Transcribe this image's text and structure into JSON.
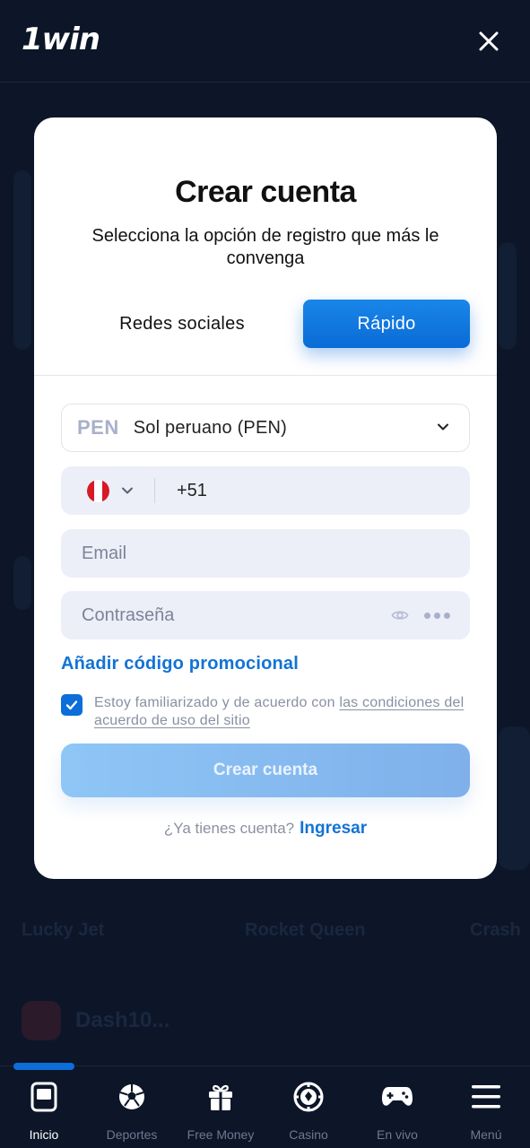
{
  "header": {
    "logo_text": "1win"
  },
  "background": {
    "games": [
      "Lucky Jet",
      "Rocket Queen",
      "Crash"
    ],
    "row_label": "Dash10..."
  },
  "modal": {
    "title": "Crear cuenta",
    "subtitle": "Selecciona la opción de registro que más le convenga",
    "tabs": {
      "social": "Redes sociales",
      "fast": "Rápido",
      "active": "fast"
    },
    "currency": {
      "code": "PEN",
      "name": "Sol peruano (PEN)"
    },
    "phone": {
      "country": "Peru",
      "value": "+51"
    },
    "email": {
      "placeholder": "Email"
    },
    "password": {
      "placeholder": "Contraseña"
    },
    "promo_link": "Añadir código promocional",
    "terms": {
      "checked": true,
      "text": "Estoy familiarizado y de acuerdo con ",
      "link": "las condiciones del acuerdo de uso del sitio"
    },
    "submit_label": "Crear cuenta",
    "login_prompt": "¿Ya tienes cuenta?",
    "login_link": "Ingresar"
  },
  "bottom_nav": {
    "active": "Inicio",
    "items": [
      {
        "label": "Inicio",
        "icon": "home-icon"
      },
      {
        "label": "Deportes",
        "icon": "soccer-ball-icon"
      },
      {
        "label": "Free Money",
        "icon": "gift-icon"
      },
      {
        "label": "Casino",
        "icon": "casino-chip-icon"
      },
      {
        "label": "En vivo",
        "icon": "gamepad-icon"
      },
      {
        "label": "Menú",
        "icon": "hamburger-menu-icon"
      }
    ]
  },
  "colors": {
    "accent": "#0c6ed8",
    "link": "#1273d6",
    "background": "#0c1628",
    "modal": "#ffffff"
  }
}
